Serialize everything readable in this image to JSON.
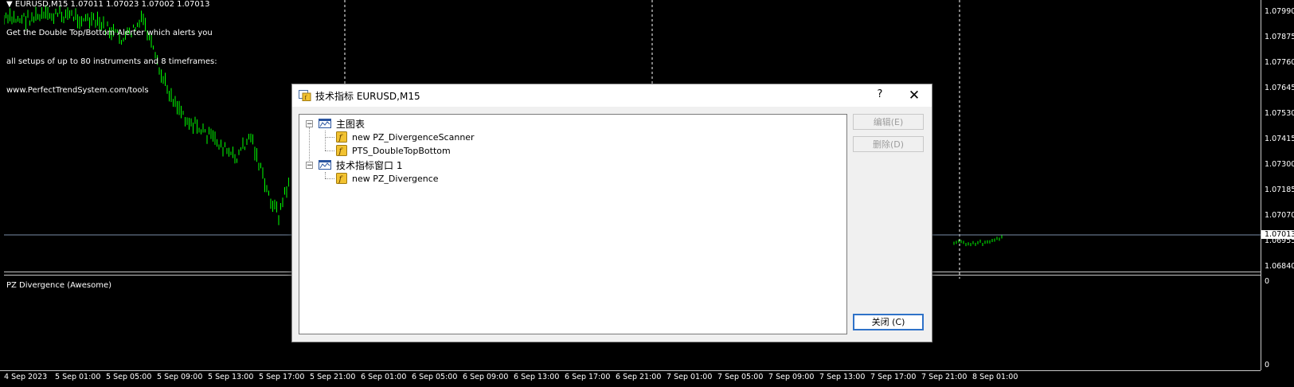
{
  "chart": {
    "header": "▼ EURUSD,M15  1.07011 1.07023 1.07002 1.07013",
    "note_lines": [
      "Get the Double Top/Bottom Alerter which alerts you",
      "all setups of up to 80 instruments and 8 timeframes:",
      "www.PerfectTrendSystem.com/tools"
    ],
    "indicator_title": "PZ Divergence (Awesome)",
    "price_labels": [
      "1.07990",
      "1.07875",
      "1.07760",
      "1.07645",
      "1.07530",
      "1.07415",
      "1.07300",
      "1.07185",
      "1.07070",
      "1.06955",
      "1.06840"
    ],
    "current_price": "1.07013",
    "indicator_labels": [
      "0",
      "0"
    ],
    "time_labels": [
      "4 Sep 2023",
      "5 Sep 01:00",
      "5 Sep 05:00",
      "5 Sep 09:00",
      "5 Sep 13:00",
      "5 Sep 17:00",
      "5 Sep 21:00",
      "6 Sep 01:00",
      "6 Sep 05:00",
      "6 Sep 09:00",
      "6 Sep 13:00",
      "6 Sep 17:00",
      "6 Sep 21:00",
      "7 Sep 01:00",
      "7 Sep 05:00",
      "7 Sep 09:00",
      "7 Sep 13:00",
      "7 Sep 17:00",
      "7 Sep 21:00",
      "8 Sep 01:00"
    ],
    "colors": {
      "background": "#000000",
      "candles": "#00ff00",
      "grid": "#ffffff",
      "bid_line": "#7a8ea8"
    }
  },
  "dialog": {
    "title": "技术指标 EURUSD,M15",
    "help_label": "?",
    "close_icon_label": "✕",
    "tree": {
      "main_chart": "主图表",
      "main_items": [
        "new PZ_DivergenceScanner",
        "PTS_DoubleTopBottom"
      ],
      "sub_window": "技术指标窗口 1",
      "sub_items": [
        "new PZ_Divergence"
      ]
    },
    "buttons": {
      "edit": "编辑(E)",
      "delete": "删除(D)",
      "close": "关闭 (C)"
    },
    "colors": {
      "accent": "#2f72c8",
      "disabled_text": "#9d9d9d",
      "indicator_icon": "#f2c230"
    }
  }
}
